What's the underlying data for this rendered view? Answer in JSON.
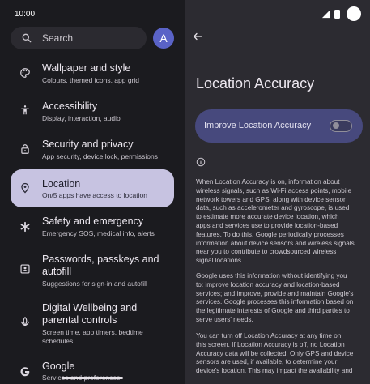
{
  "status_bar": {
    "time": "10:00"
  },
  "search": {
    "placeholder": "Search"
  },
  "account": {
    "avatar_letter": "A"
  },
  "settings_menu": [
    {
      "title": "Wallpaper and style",
      "subtitle": "Colours, themed icons, app grid",
      "icon": "palette-icon"
    },
    {
      "title": "Accessibility",
      "subtitle": "Display, interaction, audio",
      "icon": "accessibility-icon"
    },
    {
      "title": "Security and privacy",
      "subtitle": "App security, device lock, permissions",
      "icon": "lock-icon"
    },
    {
      "title": "Location",
      "subtitle": "On/5 apps have access to location",
      "icon": "location-pin-icon",
      "selected": true
    },
    {
      "title": "Safety and emergency",
      "subtitle": "Emergency SOS, medical info, alerts",
      "icon": "asterisk-icon"
    },
    {
      "title_lines": [
        "Passwords, passkeys and",
        "autofill"
      ],
      "subtitle": "Suggestions for sign-in and autofill",
      "icon": "account-box-icon"
    },
    {
      "title_lines": [
        "Digital Wellbeing and",
        "parental controls"
      ],
      "subtitle_lines": [
        "Screen time, app timers, bedtime",
        "schedules"
      ],
      "icon": "wellbeing-icon"
    },
    {
      "title": "Google",
      "subtitle": "Services and preferences",
      "icon": "google-icon"
    }
  ],
  "detail": {
    "title": "Location Accuracy",
    "toggle": {
      "label": "Improve Location Accuracy",
      "checked": false
    },
    "paragraphs": [
      [
        "When Location Accuracy is on, information about",
        "wireless signals, such as Wi-Fi access points, mobile",
        "network towers and GPS, along with device sensor",
        "data, such as accelerometer and gyroscope, is used",
        "to estimate more accurate device location, which",
        "apps and services use to provide location-based",
        "features. To do this, Google periodically processes",
        "information about device sensors and wireless signals",
        "near you to contribute to crowdsourced wireless",
        "signal locations."
      ],
      [
        "Google uses this information without identifying you",
        "to: improve location accuracy and location-based",
        "services; and improve, provide and maintain Google's",
        "services. Google processes this information based on",
        "the legitimate interests of Google and third parties to",
        "serve users' needs."
      ],
      [
        "You can turn off Location Accuracy at any time on",
        "this screen. If Location Accuracy is off, no Location",
        "Accuracy data will be collected. Only GPS and device",
        "sensors are used, if available, to determine your",
        "device's location. This may impact the availability and"
      ]
    ]
  },
  "colors": {
    "background": "#1b1b1f",
    "detail_background": "#2c2b31",
    "selected_item": "#c7c3e1",
    "toggle_card": "#47497d",
    "avatar": "#5a63c7"
  }
}
